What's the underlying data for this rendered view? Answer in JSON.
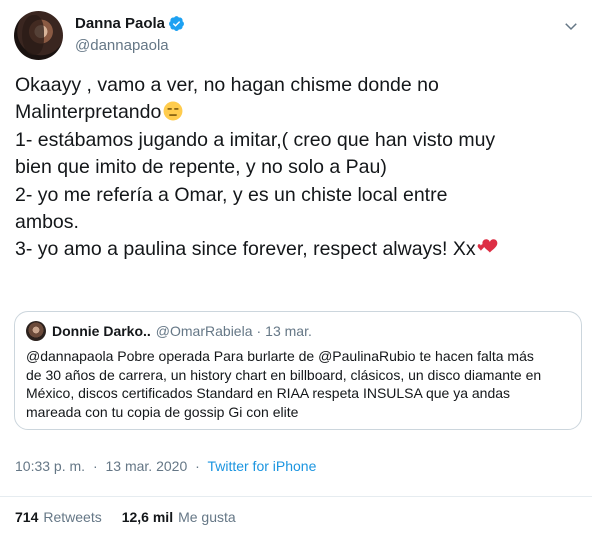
{
  "author": {
    "display_name": "Danna Paola",
    "handle": "@dannapaola"
  },
  "tweet": {
    "lines": [
      "Okaayy , vamo a ver, no hagan chisme donde no",
      "Malinterpretando",
      "1- estábamos jugando a imitar,( creo que han visto muy",
      "bien que imito de repente, y no solo a Pau)",
      "2- yo me refería a Omar, y es un chiste local entre",
      "ambos.",
      "3- yo amo a paulina since forever, respect always! Xx"
    ]
  },
  "quoted_tweet": {
    "display_name": "Donnie Darko..",
    "handle": "@OmarRabiela",
    "separator": "·",
    "date": "13 mar.",
    "lines": [
      "@dannapaola  Pobre operada Para burlarte de @PaulinaRubio  te hacen falta más",
      "de 30 años de carrera, un history chart en billboard, clásicos, un disco diamante en",
      "México, discos certificados Standard en RIAA respeta INSULSA que ya andas",
      "mareada con tu copia de gossip Gi con elite"
    ]
  },
  "meta": {
    "time": "10:33 p. m.",
    "dot1": "·",
    "date": "13 mar. 2020",
    "dot2": "·",
    "source": "Twitter for iPhone"
  },
  "stats": {
    "retweets_count": "714",
    "retweets_label": "Retweets",
    "likes_count": "12,6 mil",
    "likes_label": "Me gusta"
  },
  "colors": {
    "accent": "#1da1f2",
    "link": "#1b95e0",
    "secondary_text": "#657786",
    "heart": "#e0245e"
  },
  "icons": {
    "verified": "verified-badge-icon",
    "caret": "chevron-down-icon",
    "face_emoji": "expressionless-face-emoji",
    "heart_emoji": "two-hearts-emoji"
  }
}
